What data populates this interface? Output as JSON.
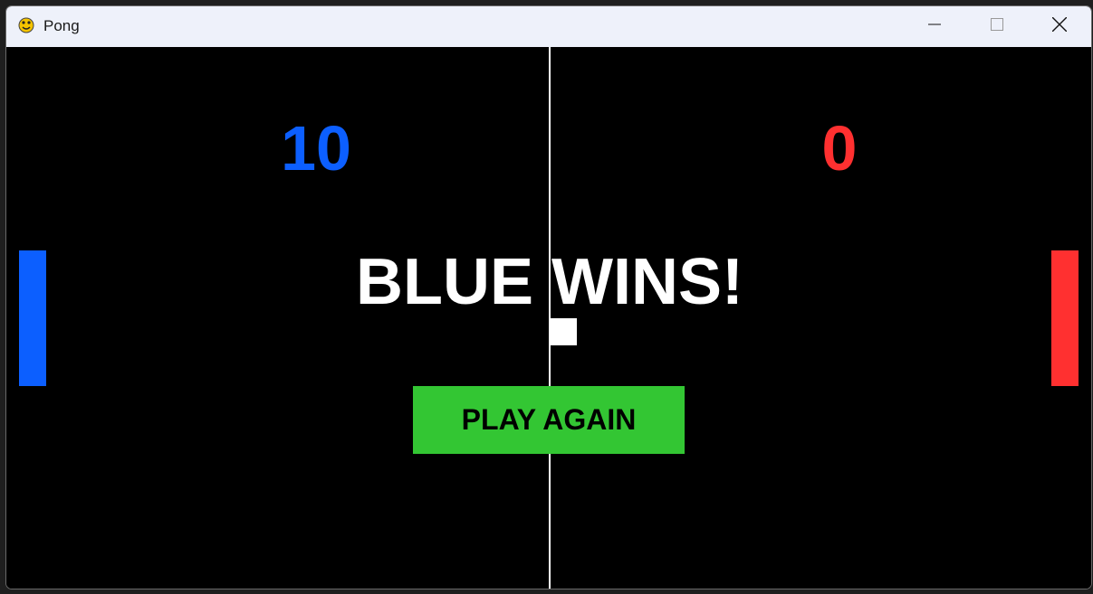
{
  "window": {
    "title": "Pong",
    "icon": "pygame-snake-icon"
  },
  "controls": {
    "minimize_icon": "minimize-icon",
    "maximize_icon": "maximize-icon",
    "close_icon": "close-icon"
  },
  "game": {
    "score_left": "10",
    "score_right": "0",
    "message": "BLUE WINS!",
    "play_again_label": "PLAY AGAIN",
    "colors": {
      "blue": "#0c5fff",
      "red": "#ff3030",
      "button": "#33c633",
      "background": "#000000",
      "line": "#ffffff"
    }
  }
}
